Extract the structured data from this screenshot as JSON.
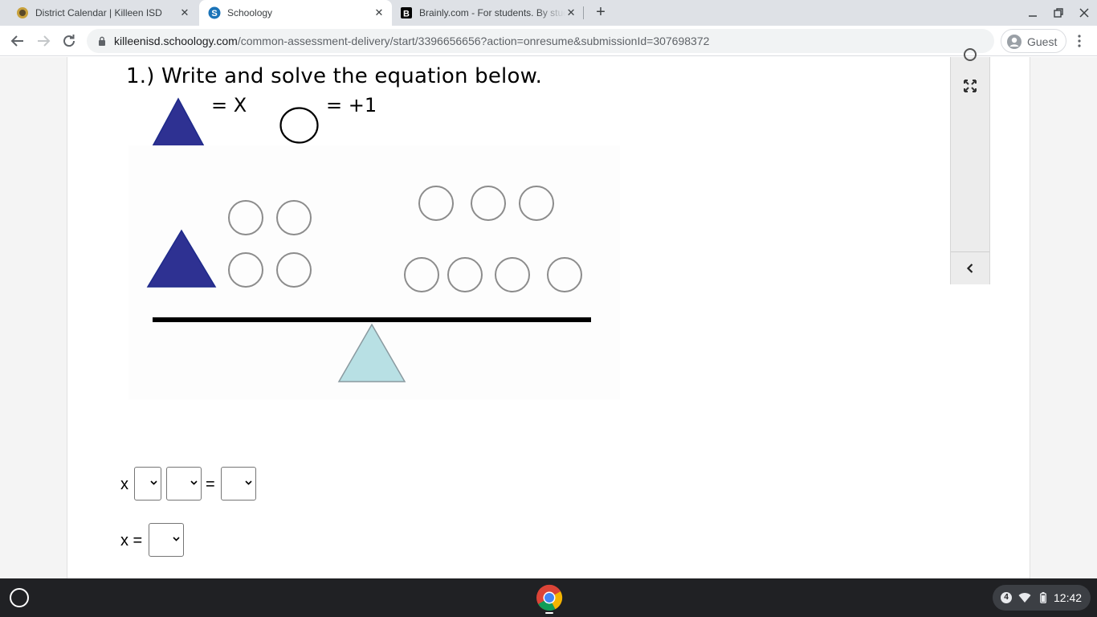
{
  "browser": {
    "tabs": [
      {
        "title": "District Calendar | Killeen ISD",
        "active": false
      },
      {
        "title": "Schoology",
        "active": true
      },
      {
        "title": "Brainly.com - For students. By students.",
        "active": false
      }
    ],
    "url_host": "killeenisd.schoology.com",
    "url_path": "/common-assessment-delivery/start/3396656656?action=onresume&submissionId=307698372",
    "profile_label": "Guest"
  },
  "question": {
    "title": "1.) Write and solve the equation below.",
    "legend_triangle": "= X",
    "legend_circle": "= +1",
    "left_side": {
      "triangles": 1,
      "circles": 4
    },
    "right_side": {
      "circles": 7
    }
  },
  "answer": {
    "row1_var": "x",
    "row1_eq": "=",
    "row2_label": "x ="
  },
  "shelf": {
    "notification_count": "4",
    "time": "12:42"
  },
  "colors": {
    "triangle_fill": "#2e3192",
    "fulcrum_fill": "#b8e0e4",
    "tab_strip": "#dee1e6",
    "shelf": "#202124"
  }
}
